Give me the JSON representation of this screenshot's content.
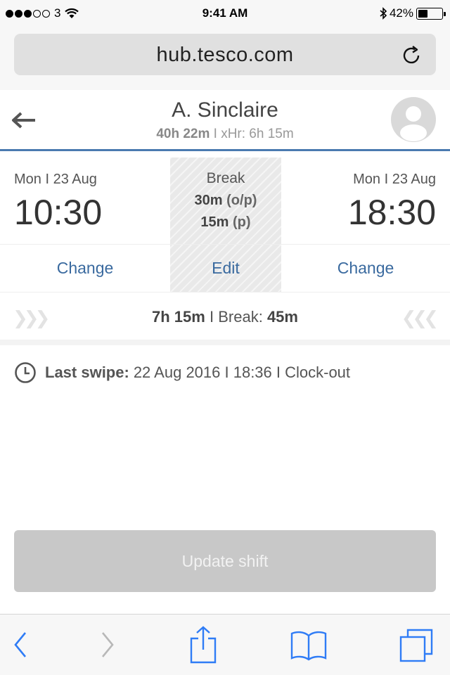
{
  "status_bar": {
    "carrier": "3",
    "time": "9:41 AM",
    "battery": "42%",
    "battery_level": 0.42
  },
  "browser": {
    "url": "hub.tesco.com"
  },
  "header": {
    "name": "A. Sinclaire",
    "hours_total": "40h 22m",
    "hours_extra": "I xHr: 6h 15m"
  },
  "shift": {
    "start": {
      "date": "Mon I 23 Aug",
      "time": "10:30",
      "change_label": "Change"
    },
    "end": {
      "date": "Mon I 23 Aug",
      "time": "18:30",
      "change_label": "Change"
    },
    "break": {
      "title": "Break",
      "line1_value": "30m",
      "line1_unit": "(o/p)",
      "line2_value": "15m",
      "line2_unit": "(p)",
      "edit_label": "Edit"
    }
  },
  "summary": {
    "duration": "7h 15m",
    "separator": "I",
    "break_label": "Break:",
    "break_value": "45m"
  },
  "last_swipe": {
    "label": "Last swipe:",
    "value": "22 Aug 2016 I 18:36 I Clock-out"
  },
  "actions": {
    "update_label": "Update shift"
  },
  "colors": {
    "accent": "#4a7ab0",
    "link": "#3a6a9f",
    "ios_blue": "#2f7cf6"
  }
}
